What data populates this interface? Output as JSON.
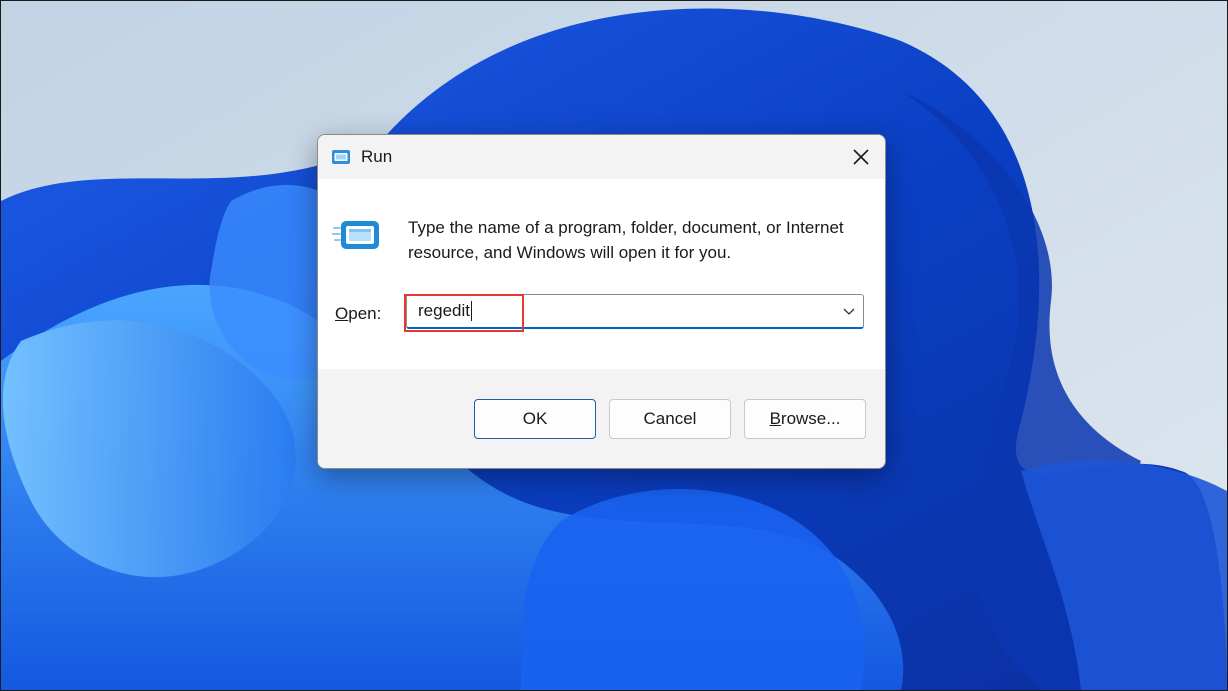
{
  "dialog": {
    "title": "Run",
    "description": "Type the name of a program, folder, document, or Internet resource, and Windows will open it for you.",
    "open_label_mnemonic": "O",
    "open_label_rest": "pen:",
    "open_value": "regedit",
    "buttons": {
      "ok": "OK",
      "cancel": "Cancel",
      "browse_mnemonic": "B",
      "browse_rest": "rowse..."
    }
  },
  "icons": {
    "title": "run-icon",
    "main": "run-icon",
    "close": "close-icon",
    "dropdown": "chevron-down-icon"
  },
  "colors": {
    "accent": "#0067c0",
    "highlight": "#e53935",
    "titlebar": "#f3f3f3",
    "footer": "#f3f3f3"
  }
}
